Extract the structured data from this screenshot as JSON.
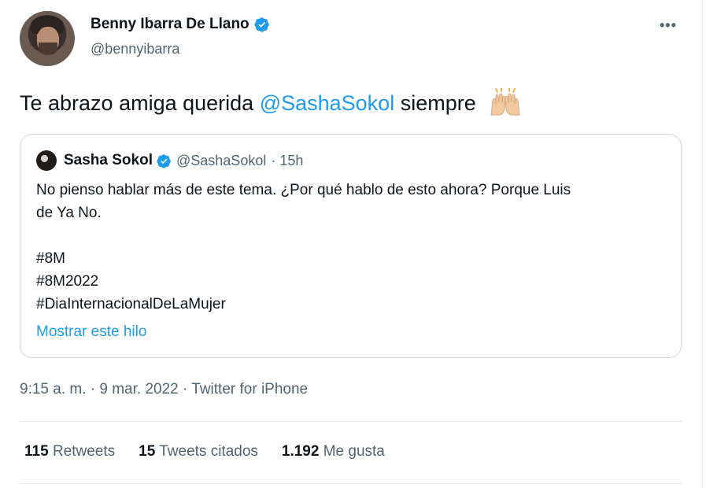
{
  "author": {
    "name": "Benny Ibarra De Llano",
    "handle": "@bennyibarra",
    "verified": true
  },
  "more_label": "•••",
  "tweet": {
    "text_before": "Te abrazo amiga querida ",
    "mention": "@SashaSokol",
    "text_after": " siempre",
    "emoji": "raising-hands-emoji"
  },
  "quoted": {
    "name": "Sasha Sokol",
    "handle": "@SashaSokol",
    "time": "· 15h",
    "lines": [
      "No pienso hablar más de este tema. ¿Por qué hablo de esto ahora? Porque Luis",
      "de Ya No.",
      "",
      "#8M",
      "#8M2022",
      "#DiaInternacionalDeLaMujer"
    ],
    "show_thread": "Mostrar este hilo"
  },
  "meta": "9:15 a. m. · 9 mar. 2022 · Twitter for iPhone",
  "stats": {
    "retweets": {
      "count": "115",
      "label": "Retweets"
    },
    "quotes": {
      "count": "15",
      "label": "Tweets citados"
    },
    "likes": {
      "count": "1.192",
      "label": "Me gusta"
    }
  },
  "colors": {
    "accent": "#1d9bf0",
    "secondary_text": "#536471"
  }
}
